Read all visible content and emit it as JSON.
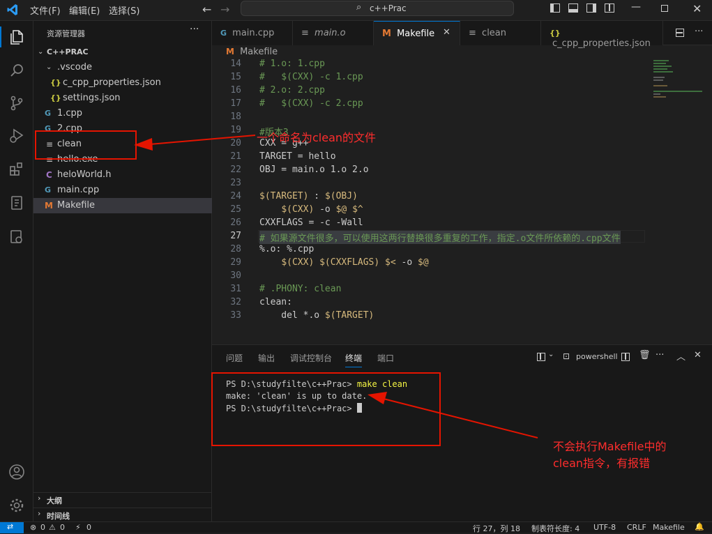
{
  "title": {
    "menu": [
      "文件(F)",
      "编辑(E)",
      "选择(S)"
    ],
    "search": "c++Prac"
  },
  "sidebar": {
    "header": "资源管理器",
    "root": "C++PRAC",
    "items": [
      {
        "label": ".vscode",
        "icon": "chevron-down"
      },
      {
        "label": "c_cpp_properties.json",
        "icon": "json"
      },
      {
        "label": "settings.json",
        "icon": "json"
      },
      {
        "label": "1.cpp",
        "icon": "cpp"
      },
      {
        "label": "2.cpp",
        "icon": "cpp"
      },
      {
        "label": "clean",
        "icon": "text"
      },
      {
        "label": "hello.exe",
        "icon": "text"
      },
      {
        "label": "heloWorld.h",
        "icon": "c"
      },
      {
        "label": "main.cpp",
        "icon": "cpp"
      },
      {
        "label": "Makefile",
        "icon": "makefile"
      }
    ],
    "outline": "大纲",
    "timeline": "时间线"
  },
  "tabs": [
    {
      "label": "main.cpp"
    },
    {
      "label": "main.o"
    },
    {
      "label": "Makefile"
    },
    {
      "label": "clean"
    },
    {
      "label": "c_cpp_properties.json"
    }
  ],
  "breadcrumb": "Makefile",
  "code": {
    "lines": [
      "14",
      "15",
      "16",
      "17",
      "18",
      "19",
      "20",
      "21",
      "22",
      "23",
      "24",
      "25",
      "26",
      "27",
      "28",
      "29",
      "30",
      "31",
      "32",
      "33"
    ],
    "l14": "# 1.o: 1.cpp",
    "l15": "#   $(CXX) -c 1.cpp",
    "l16": "# 2.o: 2.cpp",
    "l17": "#   $(CXX) -c 2.cpp",
    "l19": "#版本3",
    "l20": "CXX = g++",
    "l21": "TARGET = hello",
    "l22": "OBJ = main.o 1.o 2.o",
    "l24a": "$(TARGET)",
    "l24b": " : ",
    "l24c": "$(OBJ)",
    "l25a": "    ",
    "l25b": "$(CXX)",
    "l25c": " -o ",
    "l25d": "$@ $^",
    "l26": "CXXFLAGS = -c -Wall",
    "l27": "# 如果源文件很多，可以使用这两行替换很多重复的工作，指定.o文件所依赖的.cpp文件",
    "l28": "%.o: %.cpp",
    "l29a": "    ",
    "l29b": "$(CXX) $(CXXFLAGS) $<",
    "l29c": " -o ",
    "l29d": "$@",
    "l31": "# .PHONY: clean",
    "l32": "clean:",
    "l33a": "    del *.o ",
    "l33b": "$(TARGET)"
  },
  "panel": {
    "tabs": [
      "问题",
      "输出",
      "调试控制台",
      "终端",
      "端口"
    ],
    "shell": "powershell",
    "terminal": {
      "prompt1": "PS D:\\studyfilte\\c++Prac> ",
      "cmd1": "make clean",
      "out1": "make: 'clean' is up to date.",
      "prompt2": "PS D:\\studyfilte\\c++Prac> "
    }
  },
  "annotations": {
    "a1": "一个命名为clean的文件",
    "a2_line1": "不会执行Makefile中的",
    "a2_line2": "clean指令，有报错"
  },
  "status": {
    "errors": "0",
    "warnings": "0",
    "ports": "0",
    "position": "行 27，列 18",
    "tabsize": "制表符长度: 4",
    "encoding": "UTF-8",
    "eol": "CRLF",
    "lang": "Makefile"
  },
  "colors": {
    "accent": "#0078d4",
    "annotation": "#e51400"
  }
}
